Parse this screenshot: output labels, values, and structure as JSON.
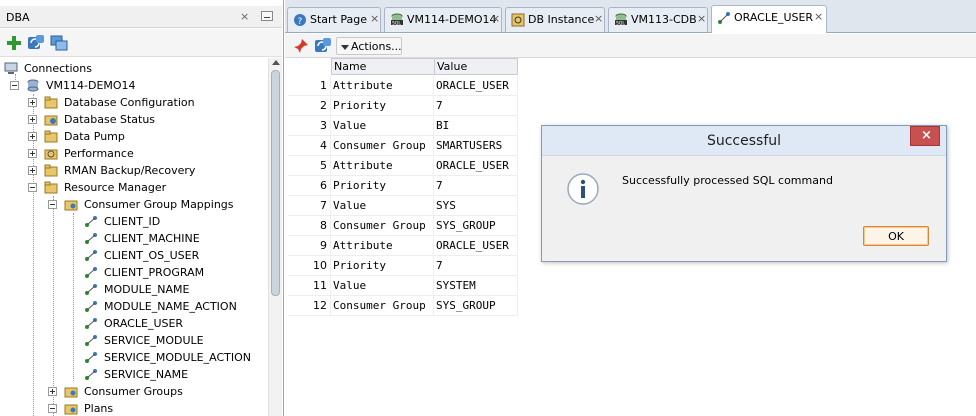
{
  "left_panel": {
    "title": "DBA",
    "close_glyph": "×",
    "tools": [
      "add-connection-icon",
      "refresh-icon",
      "filter-icon"
    ],
    "tree": {
      "root": "Connections",
      "connection": "VM114-DEMO14",
      "children": [
        "Database Configuration",
        "Database Status",
        "Data Pump",
        "Performance",
        "RMAN Backup/Recovery",
        "Resource Manager"
      ],
      "resource_manager": {
        "mappings_label": "Consumer Group Mappings",
        "mappings": [
          "CLIENT_ID",
          "CLIENT_MACHINE",
          "CLIENT_OS_USER",
          "CLIENT_PROGRAM",
          "MODULE_NAME",
          "MODULE_NAME_ACTION",
          "ORACLE_USER",
          "SERVICE_MODULE",
          "SERVICE_MODULE_ACTION",
          "SERVICE_NAME"
        ],
        "consumer_groups": "Consumer Groups",
        "plans": "Plans"
      }
    }
  },
  "tabs": [
    {
      "label": "Start Page",
      "icon": "help-icon"
    },
    {
      "label": "VM114-DEMO14",
      "icon": "sql-icon"
    },
    {
      "label": "DB Instance",
      "icon": "db-instance-icon"
    },
    {
      "label": "VM113-CDB",
      "icon": "sql-icon"
    },
    {
      "label": "ORACLE_USER",
      "icon": "mapping-icon"
    }
  ],
  "tab_close_glyph": "×",
  "editor_toolbar": {
    "actions_label": "Actions..."
  },
  "grid": {
    "headers": [
      "Name",
      "Value"
    ],
    "rows": [
      {
        "n": "1",
        "name": "Attribute",
        "value": "ORACLE_USER"
      },
      {
        "n": "2",
        "name": "Priority",
        "value": "7"
      },
      {
        "n": "3",
        "name": "Value",
        "value": "BI"
      },
      {
        "n": "4",
        "name": "Consumer Group",
        "value": "SMARTUSERS"
      },
      {
        "n": "5",
        "name": "Attribute",
        "value": "ORACLE_USER"
      },
      {
        "n": "6",
        "name": "Priority",
        "value": "7"
      },
      {
        "n": "7",
        "name": "Value",
        "value": "SYS"
      },
      {
        "n": "8",
        "name": "Consumer Group",
        "value": "SYS_GROUP"
      },
      {
        "n": "9",
        "name": "Attribute",
        "value": "ORACLE_USER"
      },
      {
        "n": "10",
        "name": "Priority",
        "value": "7"
      },
      {
        "n": "11",
        "name": "Value",
        "value": "SYSTEM"
      },
      {
        "n": "12",
        "name": "Consumer Group",
        "value": "SYS_GROUP"
      }
    ]
  },
  "dialog": {
    "title": "Successful",
    "close_glyph": "×",
    "message": "Successfully processed SQL command",
    "ok_label": "OK",
    "icon": "info-icon"
  },
  "colors": {
    "tab_bar": "#dfe6ee",
    "dialog_close": "#c75050",
    "ok_border": "#d08a3a"
  }
}
